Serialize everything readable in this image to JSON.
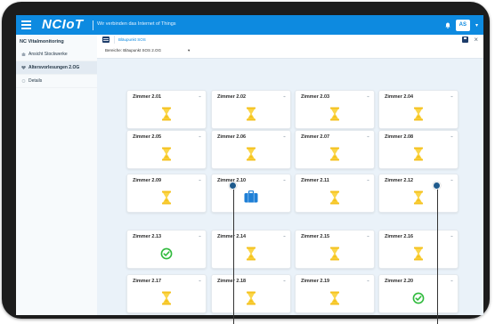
{
  "app": {
    "logo": "NCIoT",
    "slogan": "Wir verbinden das Internet of Things",
    "user_initials": "AS"
  },
  "sidebar": {
    "title": "NC Vitalmonitoring",
    "items": [
      {
        "label": "Ansicht Stockwerke",
        "active": false
      },
      {
        "label": "Altersvorlesungen 2.OG",
        "active": true
      },
      {
        "label": "Details",
        "active": false
      }
    ]
  },
  "tab": {
    "label": "Bläupunkt SOS"
  },
  "filter": {
    "label": "Bereiche: Bläupunkt SOS 2.OG"
  },
  "colors": {
    "brand": "#0d8ae0",
    "hourglass": "#f4c21f",
    "ok": "#2fba3c",
    "alert_blue": "#1e7fd6"
  },
  "rooms": [
    {
      "name": "Zimmer 2.01",
      "status": "hourglass-icon"
    },
    {
      "name": "Zimmer 2.02",
      "status": "hourglass-icon"
    },
    {
      "name": "Zimmer 2.03",
      "status": "hourglass-icon"
    },
    {
      "name": "Zimmer 2.04",
      "status": "hourglass-icon"
    },
    {
      "name": "Zimmer 2.05",
      "status": "hourglass-icon"
    },
    {
      "name": "Zimmer 2.06",
      "status": "hourglass-icon"
    },
    {
      "name": "Zimmer 2.07",
      "status": "hourglass-icon"
    },
    {
      "name": "Zimmer 2.08",
      "status": "hourglass-icon"
    },
    {
      "name": "Zimmer 2.09",
      "status": "hourglass-icon"
    },
    {
      "name": "Zimmer 2.10",
      "status": "luggage-icon"
    },
    {
      "name": "Zimmer 2.11",
      "status": "hourglass-icon"
    },
    {
      "name": "Zimmer 2.12",
      "status": "hourglass-icon"
    },
    {
      "name": "Zimmer 2.13",
      "status": "check-circle-icon"
    },
    {
      "name": "Zimmer 2.14",
      "status": "hourglass-icon"
    },
    {
      "name": "Zimmer 2.15",
      "status": "hourglass-icon"
    },
    {
      "name": "Zimmer 2.16",
      "status": "hourglass-icon"
    },
    {
      "name": "Zimmer 2.17",
      "status": "hourglass-icon"
    },
    {
      "name": "Zimmer 2.18",
      "status": "hourglass-icon"
    },
    {
      "name": "Zimmer 2.19",
      "status": "hourglass-icon"
    },
    {
      "name": "Zimmer 2.20",
      "status": "check-circle-icon"
    }
  ]
}
